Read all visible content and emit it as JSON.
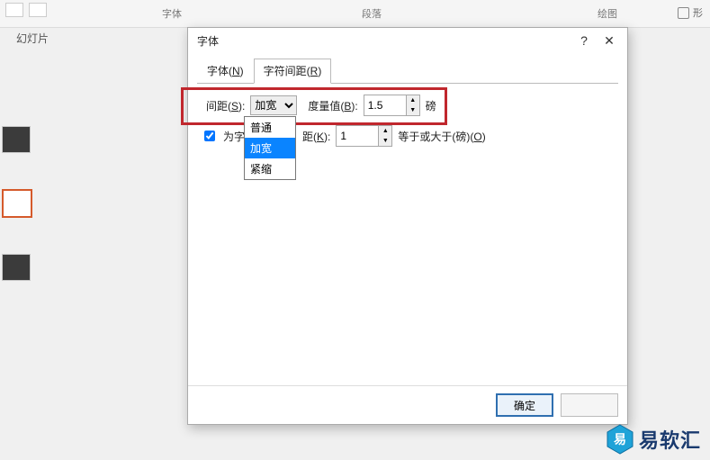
{
  "ribbon": {
    "group_font": "字体",
    "group_paragraph": "段落",
    "group_drawing": "绘图",
    "shape_label": "形",
    "slides_label": "幻灯片"
  },
  "dialog": {
    "title": "字体",
    "help_tooltip": "?",
    "tabs": {
      "font": {
        "label": "字体(N)",
        "hotkey": "N"
      },
      "spacing": {
        "label": "字符间距(R)",
        "hotkey": "R"
      }
    },
    "spacing_row": {
      "label_prefix": "间距(",
      "label_hot": "S",
      "label_suffix": "):",
      "selected": "加宽",
      "options": [
        "普通",
        "加宽",
        "紧缩"
      ],
      "by_label_prefix": "度量值(",
      "by_label_hot": "B",
      "by_label_suffix": "):",
      "by_value": "1.5",
      "unit": "磅"
    },
    "kerning_row": {
      "checked": true,
      "label_prefix": "为字体",
      "kern_label": "距(",
      "kern_hot": "K",
      "kern_suffix": "):",
      "kern_value": "1",
      "tail_prefix": "等于或大于(磅)(",
      "tail_hot": "O",
      "tail_suffix": ")"
    },
    "footer": {
      "ok": "确定",
      "cancel": ""
    }
  },
  "watermark": {
    "text": "易软汇"
  }
}
